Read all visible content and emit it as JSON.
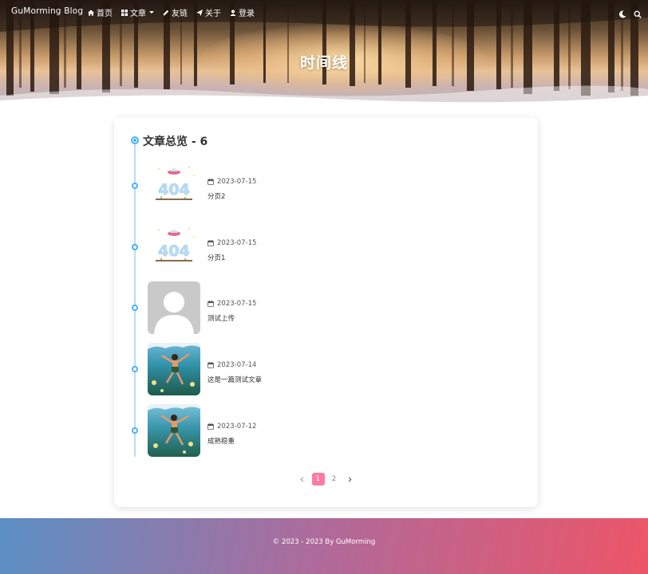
{
  "site": {
    "brand": "GuMorming Blog"
  },
  "nav": {
    "items": [
      {
        "label": "首页",
        "icon": "home-icon"
      },
      {
        "label": "文章",
        "icon": "grid-icon",
        "has_dropdown": true
      },
      {
        "label": "友链",
        "icon": "link-icon"
      },
      {
        "label": "关于",
        "icon": "paper-plane-icon"
      },
      {
        "label": "登录",
        "icon": "user-icon"
      }
    ],
    "right_icons": [
      "theme-toggle-icon",
      "search-icon"
    ]
  },
  "banner": {
    "title": "时间线"
  },
  "timeline": {
    "heading": "文章总览 - 6",
    "entries": [
      {
        "date": "2023-07-15",
        "title": "分页2",
        "thumbnail": "404-ufo-illustration"
      },
      {
        "date": "2023-07-15",
        "title": "分页1",
        "thumbnail": "404-ufo-illustration"
      },
      {
        "date": "2023-07-15",
        "title": "测试上传",
        "thumbnail": "default-avatar"
      },
      {
        "date": "2023-07-14",
        "title": "这是一篇测试文章",
        "thumbnail": "boy-jumping-into-water"
      },
      {
        "date": "2023-07-12",
        "title": "成熟稳重",
        "thumbnail": "boy-jumping-into-water"
      }
    ]
  },
  "pagination": {
    "current": "1",
    "pages": [
      "1",
      "2"
    ]
  },
  "footer": {
    "text": "© 2023 - 2023 By GuMorming"
  },
  "colors": {
    "accent": "#49b1f5",
    "timeline_line": "#b8dcf5",
    "active_page": "#ff7aa3",
    "footer_start": "#5a8fc4",
    "footer_end": "#ed5567"
  }
}
